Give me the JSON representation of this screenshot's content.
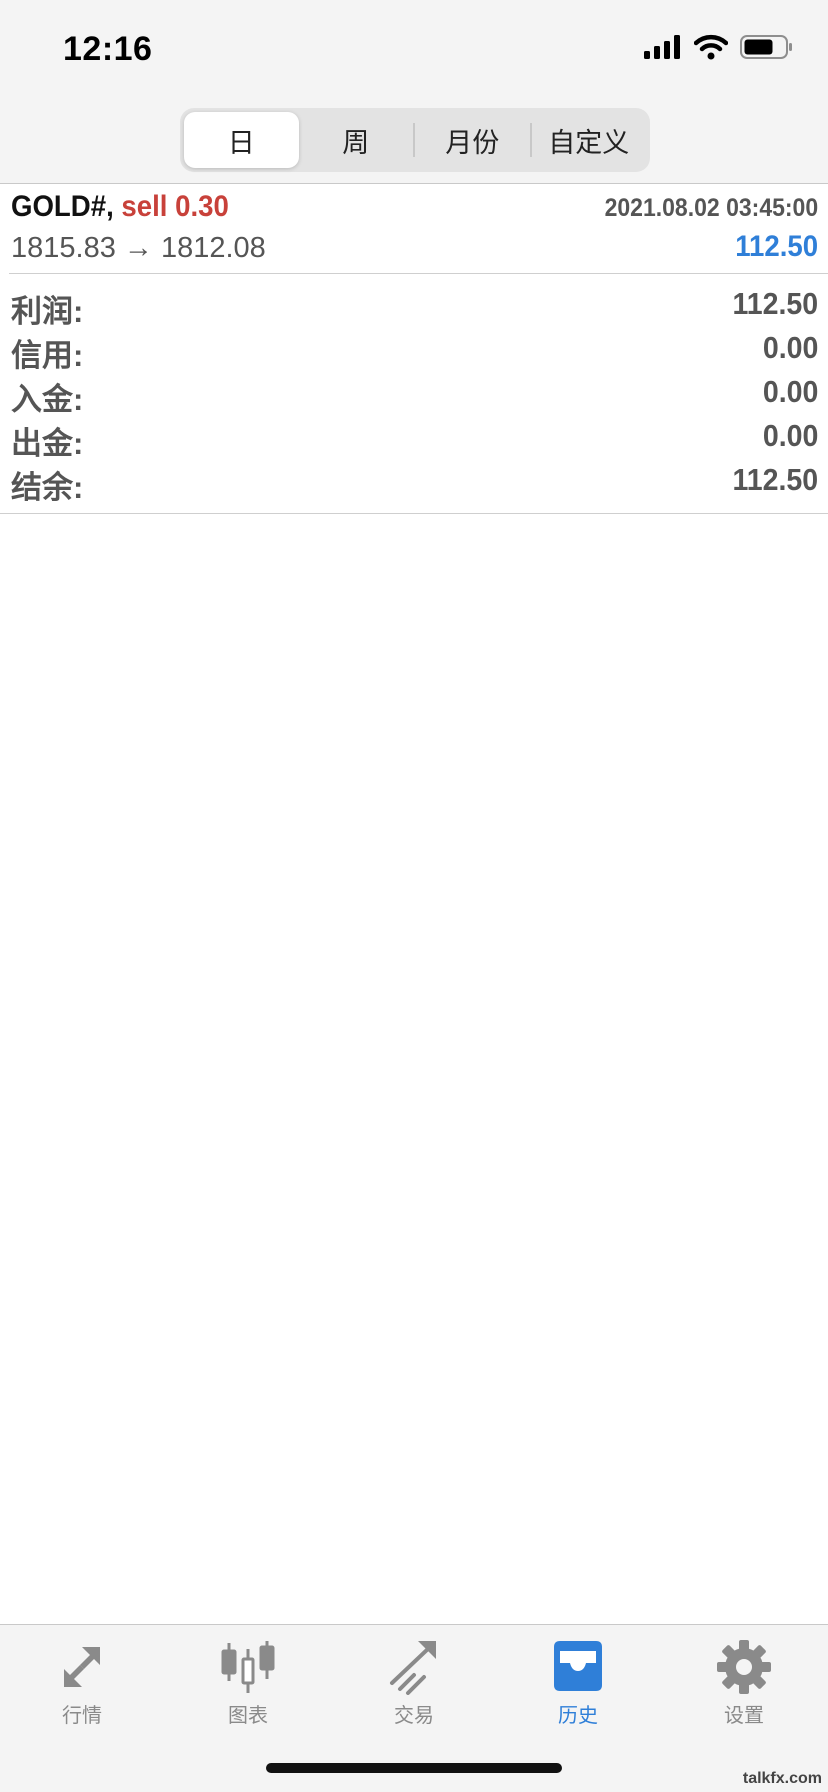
{
  "status_bar": {
    "time": "12:16",
    "icons": [
      "cellular-signal-icon",
      "wifi-icon",
      "battery-icon"
    ]
  },
  "period_tabs": [
    {
      "label": "日",
      "active": true
    },
    {
      "label": "周",
      "active": false
    },
    {
      "label": "月份",
      "active": false
    },
    {
      "label": "自定义",
      "active": false
    }
  ],
  "trade": {
    "symbol": "GOLD#,",
    "type_volume": "sell 0.30",
    "datetime": "2021.08.02 03:45:00",
    "prices": "1815.83 → 1812.08",
    "profit": "112.50"
  },
  "summary": [
    {
      "label": "利润:",
      "value": "112.50"
    },
    {
      "label": "信用:",
      "value": "0.00"
    },
    {
      "label": "入金:",
      "value": "0.00"
    },
    {
      "label": "出金:",
      "value": "0.00"
    },
    {
      "label": "结余:",
      "value": "112.50"
    }
  ],
  "tabbar": [
    {
      "label": "行情",
      "icon": "quotes-arrows-icon",
      "active": false
    },
    {
      "label": "图表",
      "icon": "candlestick-chart-icon",
      "active": false
    },
    {
      "label": "交易",
      "icon": "trade-trend-icon",
      "active": false
    },
    {
      "label": "历史",
      "icon": "history-inbox-icon",
      "active": true
    },
    {
      "label": "设置",
      "icon": "gear-icon",
      "active": false
    }
  ],
  "watermark": "talkfx.com",
  "colors": {
    "sell": "#c8413a",
    "profit_blue": "#2f7fd8",
    "tab_active": "#2f7fd8",
    "tab_inactive": "#8a8a8a"
  }
}
